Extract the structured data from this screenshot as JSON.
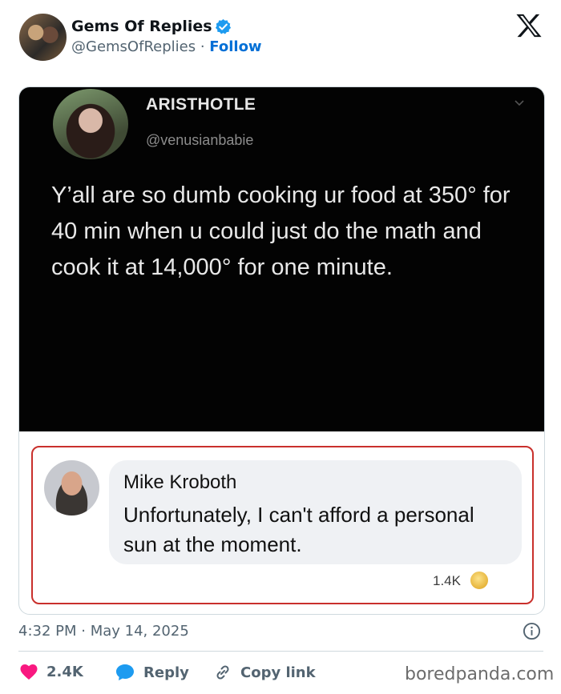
{
  "header": {
    "display_name": "Gems Of Replies",
    "handle": "@GemsOfReplies",
    "separator": "·",
    "follow_label": "Follow"
  },
  "embedded_tweet": {
    "name": "ARISTHOTLE",
    "handle": "@venusianbabie",
    "text": "Y’all are so dumb cooking ur food at 350° for 40 min when u could just do the math and cook it at 14,000° for one minute."
  },
  "reply": {
    "name": "Mike Kroboth",
    "text": "Unfortunately, I can't afford a personal sun at the moment.",
    "reaction_count": "1.4K"
  },
  "footer": {
    "timestamp": "4:32 PM · May 14, 2025",
    "likes": "2.4K",
    "reply_label": "Reply",
    "copy_label": "Copy link"
  },
  "watermark": "boredpanda.com",
  "colors": {
    "follow": "#006fd6",
    "verified": "#1d9bf0",
    "like": "#f91880",
    "reply_icon": "#1d9bf0",
    "reply_frame": "#c9302c"
  },
  "icons": [
    "verified-icon",
    "x-logo-icon",
    "chevron-down-icon",
    "info-icon",
    "heart-icon",
    "reply-bubble-icon",
    "link-icon",
    "reaction-emoji-icon"
  ]
}
